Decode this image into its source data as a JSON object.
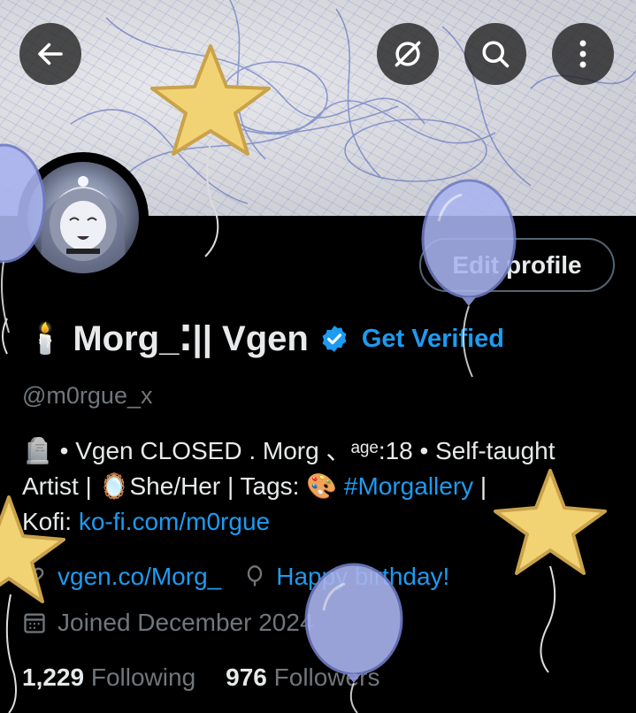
{
  "header": {
    "back_icon": "arrow-left-icon",
    "hide_icon": "eye-slash-icon",
    "search_icon": "search-icon",
    "more_icon": "more-vertical-icon"
  },
  "profile": {
    "name_prefix_emoji": "🕯️",
    "display_name": "Morg_⁚|| Vgen",
    "get_verified": "Get Verified",
    "handle": "@m0rgue_x",
    "edit_profile": "Edit profile",
    "bio_lines": [
      "🪦 • Vgen CLOSED .  Morg 、ᵃᵍᵉ:18 • Self-taught",
      "Artist | 🪞She/Her | Tags: 🎨 "
    ],
    "bio_hashtag": "#Morgallery",
    "bio_tail": " |",
    "bio_kofi_label": "Kofi: ",
    "bio_kofi_link": "ko-fi.com/m0rgue",
    "website": "vgen.co/Morg_",
    "birthday": "Happy birthday!",
    "joined": "Joined December 2024",
    "following_count": "1,229",
    "following_label": "Following",
    "followers_count": "976",
    "followers_label": "Followers"
  },
  "colors": {
    "background": "#000000",
    "text_primary": "#e7e9ea",
    "text_secondary": "#71767b",
    "accent": "#1d9bf0",
    "balloon": "#a9b4ef",
    "star": "#f2d374"
  }
}
